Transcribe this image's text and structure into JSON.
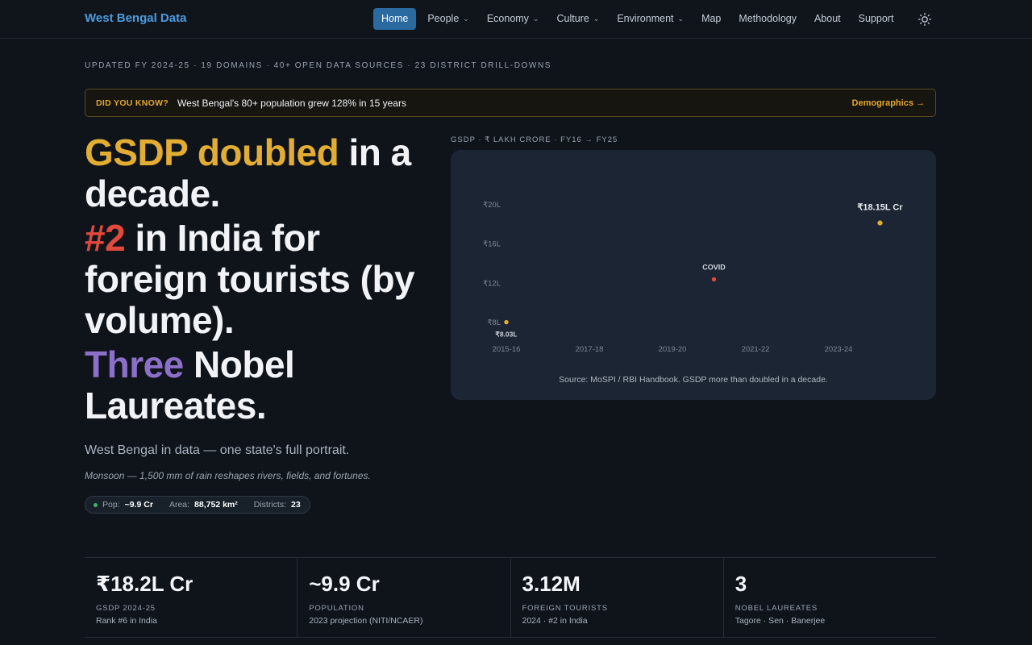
{
  "nav": {
    "brand": "West Bengal Data",
    "items": [
      {
        "label": "Home",
        "active": true,
        "dropdown": false
      },
      {
        "label": "People",
        "dropdown": true
      },
      {
        "label": "Economy",
        "dropdown": true
      },
      {
        "label": "Culture",
        "dropdown": true
      },
      {
        "label": "Environment",
        "dropdown": true
      },
      {
        "label": "Map",
        "dropdown": false
      },
      {
        "label": "Methodology",
        "dropdown": false
      },
      {
        "label": "About",
        "dropdown": false
      },
      {
        "label": "Support",
        "dropdown": false
      }
    ],
    "theme_icon": "sun-icon"
  },
  "hero": {
    "meta": "UPDATED FY 2024-25 · 19 DOMAINS · 40+ OPEN DATA SOURCES · 23 DISTRICT DRILL-DOWNS",
    "didyouknow": {
      "tag": "DID YOU KNOW?",
      "fact": "West Bengal's 80+ population grew 128% in 15 years",
      "link": "Demographics →"
    },
    "headline": {
      "line1_accent": "GSDP doubled",
      "line1_rest": " in a decade.",
      "line2_accent": "#2",
      "line2_rest": " in India for foreign tourists (by volume).",
      "line3_accent": "Three",
      "line3_rest": " Nobel Laureates."
    },
    "subtitle": "West Bengal in data — one state's full portrait.",
    "tagline": "Monsoon — 1,500 mm of rain reshapes rivers, fields, and fortunes.",
    "pill": {
      "pop_label": "Pop:",
      "pop_value": "~9.9 Cr",
      "area_label": "Area:",
      "area_value": "88,752 km²",
      "districts_label": "Districts:",
      "districts_value": "23"
    }
  },
  "chart_caption": "GSDP · ₹ LAKH CRORE · FY16 → FY25",
  "chart_data": {
    "type": "scatter",
    "x_tick_labels": [
      "2015-16",
      "2017-18",
      "2019-20",
      "2021-22",
      "2023-24"
    ],
    "y_tick_labels": [
      "₹8L",
      "₹12L",
      "₹16L",
      "₹20L"
    ],
    "y_ticks": [
      8,
      12,
      16,
      20
    ],
    "points": [
      {
        "x": "2015-16",
        "y": 8.03,
        "label": "₹8.03L",
        "color": "#e3ad33"
      },
      {
        "x": "2020-21",
        "y": 12.4,
        "label": "COVID",
        "color": "#e0493b"
      },
      {
        "x": "2024-25",
        "y": 18.15,
        "label": "₹18.15L Cr",
        "color": "#e3ad33"
      }
    ],
    "source": "Source: MoSPI / RBI Handbook. GSDP more than doubled in a decade."
  },
  "stats": [
    {
      "value": "₹18.2L Cr",
      "label": "GSDP 2024-25",
      "sub": "Rank #6 in India"
    },
    {
      "value": "~9.9 Cr",
      "label": "POPULATION",
      "sub": "2023 projection (NITI/NCAER)"
    },
    {
      "value": "3.12M",
      "label": "FOREIGN TOURISTS",
      "sub": "2024 · #2 in India"
    },
    {
      "value": "3",
      "label": "NOBEL LAUREATES",
      "sub": "Tagore · Sen · Banerjee"
    }
  ]
}
